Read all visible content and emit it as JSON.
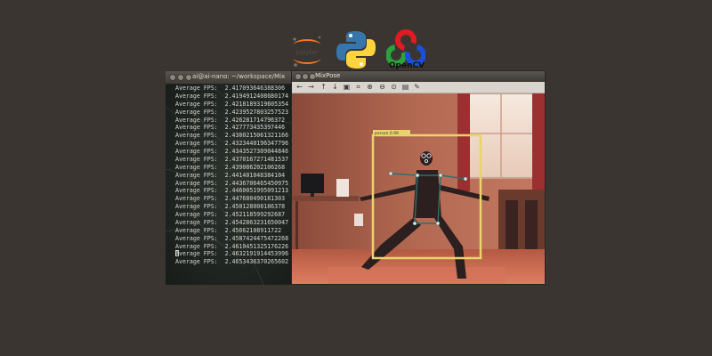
{
  "logos": {
    "jupyter_text": "jupyter",
    "opencv_text": "OpenCV"
  },
  "terminal": {
    "title": "ai@ai-nano: ~/workspace/Mix",
    "lines": [
      "Average FPS:  2.417093646388306",
      "Average FPS:  2.4194912408680174",
      "Average FPS:  2.4218189319605354",
      "Average FPS:  2.4239527803257523",
      "Average FPS:  2.426281714796372",
      "Average FPS:  2.427773435397446",
      "Average FPS:  2.4300215061321166",
      "Average FPS:  2.4323440196347796",
      "Average FPS:  2.4343527309044846",
      "Average FPS:  2.4370167271481537",
      "Average FPS:  2.439086202106268",
      "Average FPS:  2.441401048384104",
      "Average FPS:  2.4436706465450975",
      "Average FPS:  2.4460051995091213",
      "Average FPS:  2.447680490181303",
      "Average FPS:  2.450128008186378",
      "Average FPS:  2.452118599292687",
      "Average FPS:  2.4542863231650047",
      "Average FPS:  2.45662108911722",
      "Average FPS:  2.4587424475472268",
      "Average FPS:  2.4610451325176226",
      "Average FPS:  2.4632191914453996",
      "Average FPS:  2.4653436370265602"
    ]
  },
  "mixpose": {
    "title": "MixPose",
    "detection_label": "person  0.99"
  },
  "colors": {
    "background": "#3b3531",
    "bbox": "#e8d46a",
    "skeleton": "#2f6e70"
  }
}
